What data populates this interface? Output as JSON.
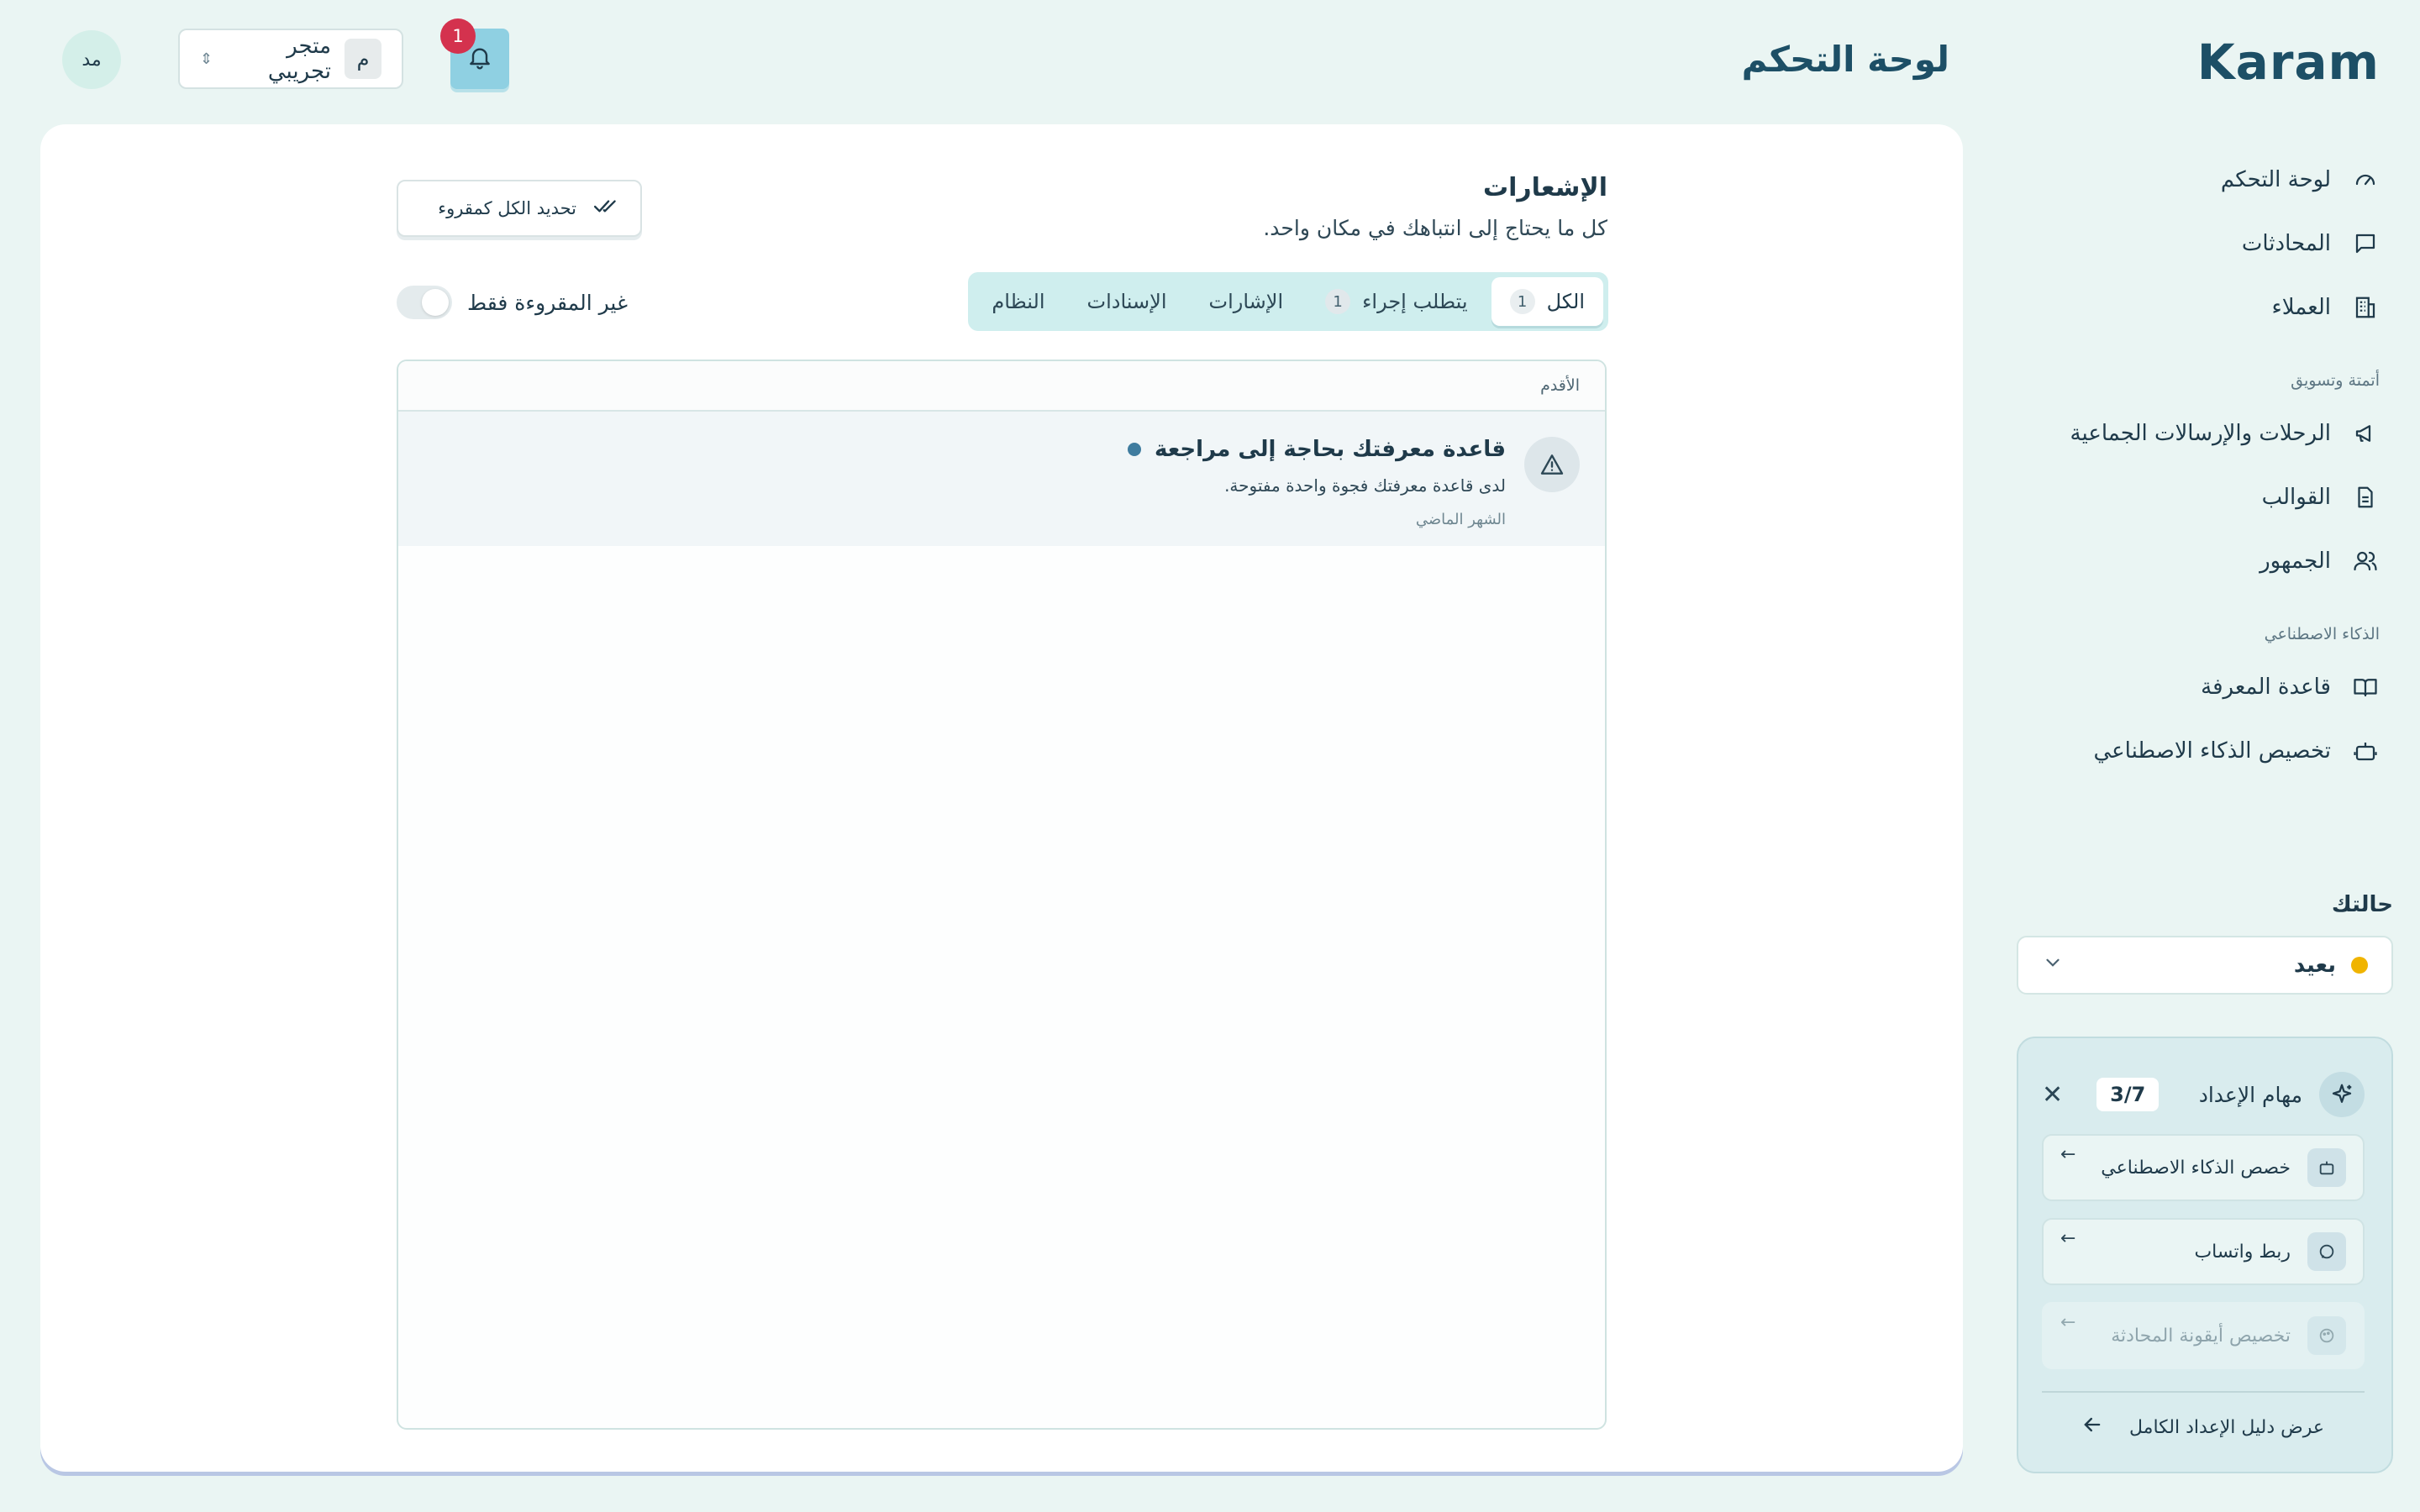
{
  "brand": {
    "logo_text": "Karam"
  },
  "header": {
    "page_title": "لوحة التحكم",
    "notification_count": "1",
    "store_name": "متجر تجريبي",
    "store_initial": "م",
    "avatar_initials": "مد"
  },
  "sidebar": {
    "items_main": [
      {
        "label": "لوحة التحكم",
        "icon": "gauge-icon"
      },
      {
        "label": "المحادثات",
        "icon": "chat-icon"
      },
      {
        "label": "العملاء",
        "icon": "building-icon"
      }
    ],
    "section_automation": "أتمتة وتسويق",
    "items_automation": [
      {
        "label": "الرحلات والإرسالات الجماعية",
        "icon": "megaphone-icon"
      },
      {
        "label": "القوالب",
        "icon": "document-icon"
      },
      {
        "label": "الجمهور",
        "icon": "users-icon"
      }
    ],
    "section_ai": "الذكاء الاصطناعي",
    "items_ai": [
      {
        "label": "قاعدة المعرفة",
        "icon": "book-icon"
      },
      {
        "label": "تخصيص الذكاء الاصطناعي",
        "icon": "bot-icon"
      }
    ],
    "status_title": "حالتك",
    "status_value": "بعيد",
    "status_color": "#f0b400",
    "setup": {
      "title": "مهام الإعداد",
      "progress": "3/7",
      "tasks": [
        {
          "label": "خصص الذكاء الاصطناعي",
          "icon": "bot-icon"
        },
        {
          "label": "ربط واتساب",
          "icon": "chat-icon"
        },
        {
          "label": "تخصيص أيقونة المحادثة",
          "icon": "palette-icon"
        }
      ],
      "footer_link": "عرض دليل الإعداد الكامل"
    }
  },
  "notifications": {
    "title": "الإشعارات",
    "subtitle": "كل ما يحتاج إلى انتباهك في مكان واحد.",
    "mark_all_label": "تحديد الكل كمقروء",
    "unread_only_label": "غير المقروءة فقط",
    "tabs": [
      {
        "label": "الكل",
        "count": "1",
        "active": true
      },
      {
        "label": "يتطلب إجراء",
        "count": "1",
        "active": false
      },
      {
        "label": "الإشارات",
        "count": "",
        "active": false
      },
      {
        "label": "الإسنادات",
        "count": "",
        "active": false
      },
      {
        "label": "النظام",
        "count": "",
        "active": false
      }
    ],
    "sort_label": "الأقدم",
    "items": [
      {
        "title": "قاعدة معرفتك بحاجة إلى مراجعة",
        "description": "لدى قاعدة معرفتك فجوة واحدة مفتوحة.",
        "time": "الشهر الماضي",
        "unread": true,
        "icon": "warning-icon"
      }
    ]
  },
  "colors": {
    "background": "#eaf5f3",
    "accent": "#1d4f66",
    "badge": "#d4324e",
    "bell_button": "#8fd0e2",
    "unread_dot": "#3f7c9f"
  }
}
